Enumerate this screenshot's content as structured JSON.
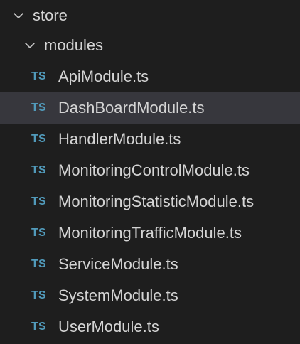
{
  "explorer": {
    "root_folder": {
      "label": "store",
      "icon": "chevron-down-icon",
      "expanded": true
    },
    "sub_folder": {
      "label": "modules",
      "icon": "chevron-down-icon",
      "expanded": true
    },
    "file_badge": "TS",
    "files": [
      {
        "label": "ApiModule.ts",
        "selected": false
      },
      {
        "label": "DashBoardModule.ts",
        "selected": true
      },
      {
        "label": "HandlerModule.ts",
        "selected": false
      },
      {
        "label": "MonitoringControlModule.ts",
        "selected": false
      },
      {
        "label": "MonitoringStatisticModule.ts",
        "selected": false
      },
      {
        "label": "MonitoringTrafficModule.ts",
        "selected": false
      },
      {
        "label": "ServiceModule.ts",
        "selected": false
      },
      {
        "label": "SystemModule.ts",
        "selected": false
      },
      {
        "label": "UserModule.ts",
        "selected": false
      }
    ],
    "colors": {
      "background": "#1e1e1e",
      "selected_row": "#37373d",
      "text": "#d4d4d4",
      "ts_badge": "#519aba",
      "indent_guide": "#585858"
    }
  }
}
